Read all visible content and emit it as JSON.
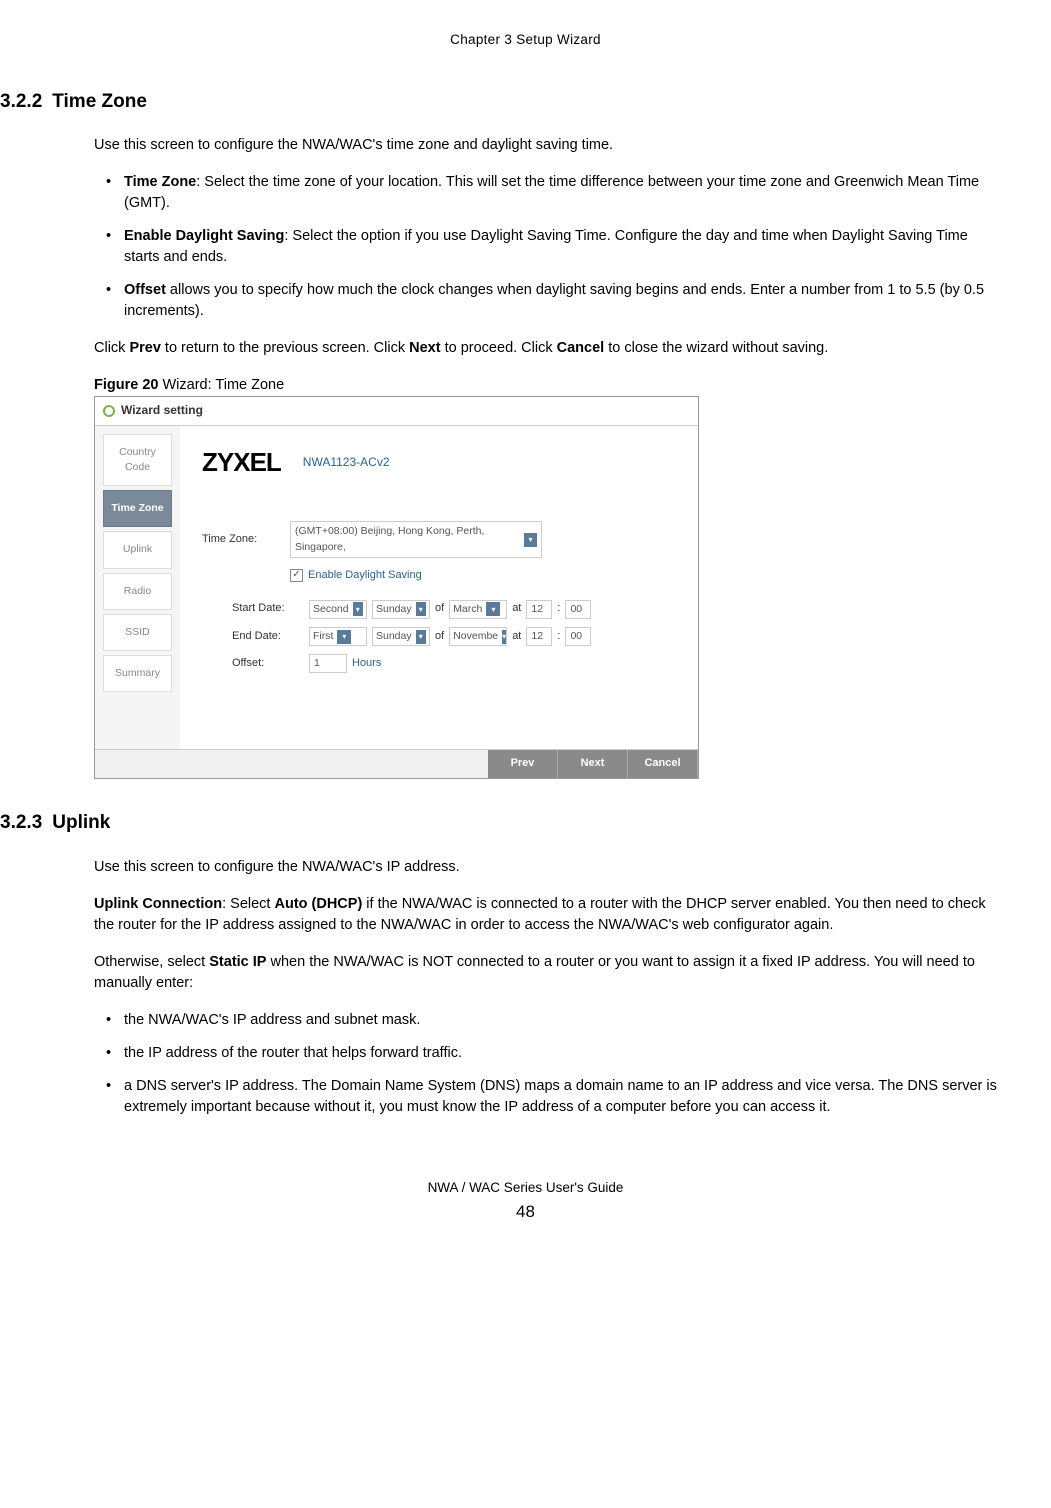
{
  "header": {
    "chapter": "Chapter 3 Setup Wizard"
  },
  "section1": {
    "number": "3.2.2",
    "title": "Time Zone",
    "intro": "Use this screen to configure the NWA/WAC's time zone and daylight saving time.",
    "bullets": [
      {
        "bold": "Time Zone",
        "text": ": Select the time zone of your location. This will set the time difference between your time zone and Greenwich Mean Time (GMT)."
      },
      {
        "bold": "Enable Daylight Saving",
        "text": ": Select the option if you use Daylight Saving Time. Configure the day and time when Daylight Saving Time starts and ends."
      },
      {
        "bold": "Offset",
        "text": " allows you to specify how much the clock changes when daylight saving begins and ends. Enter a number from 1 to 5.5 (by 0.5 increments)."
      }
    ],
    "nav_text_1": "Click ",
    "nav_prev": "Prev",
    "nav_text_2": " to return to the previous screen. Click ",
    "nav_next": "Next",
    "nav_text_3": " to proceed. Click ",
    "nav_cancel": "Cancel",
    "nav_text_4": " to close the wizard without saving."
  },
  "figure": {
    "caption_bold": "Figure 20",
    "caption_text": "   Wizard: Time Zone"
  },
  "wizard": {
    "title": "Wizard setting",
    "steps": [
      "Country Code",
      "Time Zone",
      "Uplink",
      "Radio",
      "SSID",
      "Summary"
    ],
    "active_step": 1,
    "brand": "ZYXEL",
    "model": "NWA1123-ACv2",
    "tz_label": "Time Zone:",
    "tz_value": "(GMT+08:00) Beijing, Hong Kong, Perth, Singapore,",
    "dst_checkbox_label": "Enable Daylight Saving",
    "dst_checked": true,
    "start_label": "Start Date:",
    "start_week": "Second",
    "start_day": "Sunday",
    "start_of": "of",
    "start_month": "March",
    "start_at": "at",
    "start_hour": "12",
    "start_min": "00",
    "end_label": "End Date:",
    "end_week": "First",
    "end_day": "Sunday",
    "end_month": "Novembe",
    "end_hour": "12",
    "end_min": "00",
    "offset_label": "Offset:",
    "offset_value": "1",
    "offset_unit": "Hours",
    "buttons": [
      "Prev",
      "Next",
      "Cancel"
    ]
  },
  "section2": {
    "number": "3.2.3",
    "title": "Uplink",
    "intro": "Use this screen to configure the NWA/WAC's IP address.",
    "p2_bold1": "Uplink Connection",
    "p2_text1": ": Select ",
    "p2_bold2": "Auto (DHCP)",
    "p2_text2": " if the NWA/WAC is connected to a router with the DHCP server enabled. You then need to check the router for the IP address assigned to the NWA/WAC in order to access the NWA/WAC's web configurator again.",
    "p3_text1": "Otherwise, select ",
    "p3_bold1": "Static IP",
    "p3_text2": " when the NWA/WAC is NOT connected to a router or you want to assign it a fixed IP address. You will need to manually enter:",
    "bullets": [
      "the NWA/WAC's IP address and subnet mask.",
      "the IP address of the router that helps forward traffic.",
      "a DNS server's IP address. The Domain Name System (DNS) maps a domain name to an IP address and vice versa. The DNS server is extremely important because without it, you must know the IP address of a computer before you can access it."
    ]
  },
  "footer": {
    "guide": "NWA / WAC Series User's Guide",
    "page": "48"
  }
}
